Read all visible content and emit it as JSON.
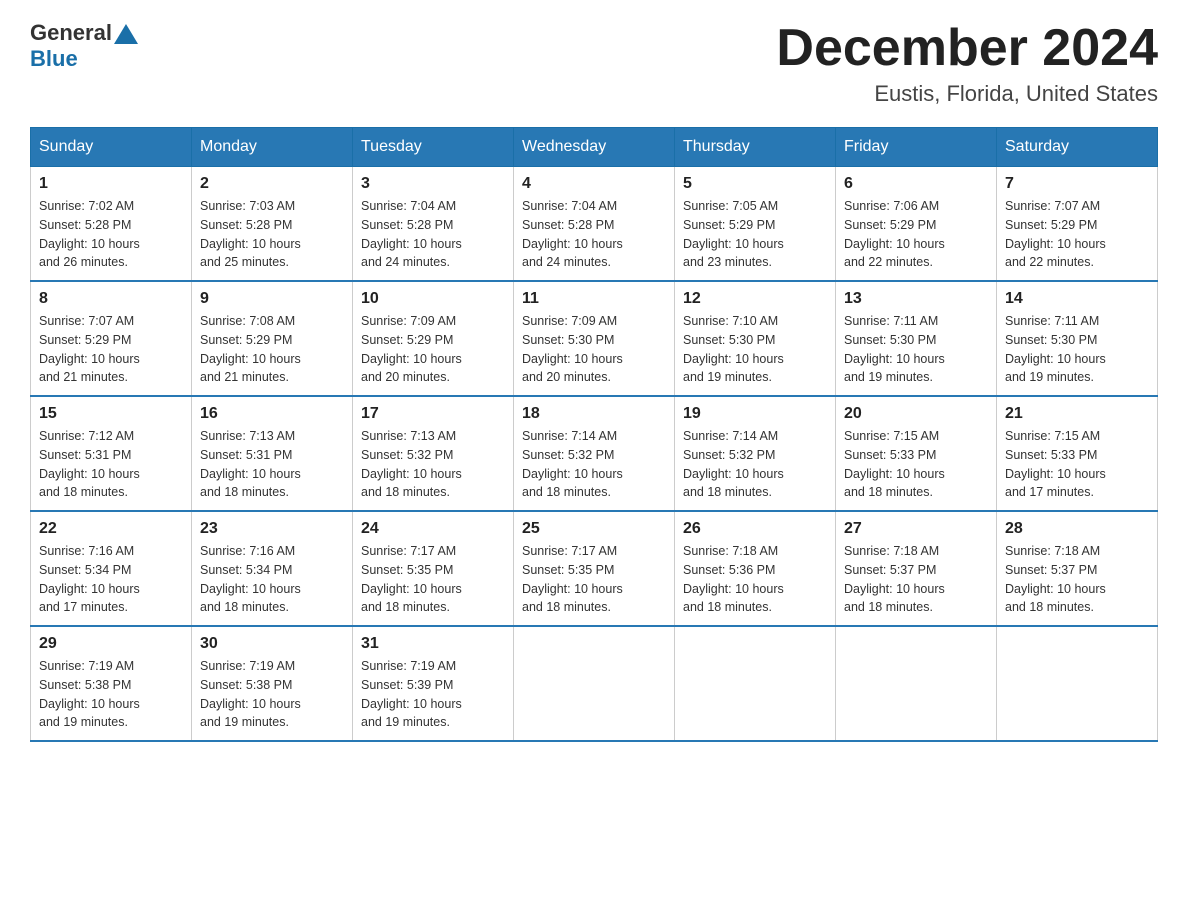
{
  "header": {
    "logo_general": "General",
    "logo_blue": "Blue",
    "month_title": "December 2024",
    "location": "Eustis, Florida, United States"
  },
  "days_of_week": [
    "Sunday",
    "Monday",
    "Tuesday",
    "Wednesday",
    "Thursday",
    "Friday",
    "Saturday"
  ],
  "weeks": [
    [
      {
        "day": "1",
        "sunrise": "7:02 AM",
        "sunset": "5:28 PM",
        "daylight": "10 hours and 26 minutes."
      },
      {
        "day": "2",
        "sunrise": "7:03 AM",
        "sunset": "5:28 PM",
        "daylight": "10 hours and 25 minutes."
      },
      {
        "day": "3",
        "sunrise": "7:04 AM",
        "sunset": "5:28 PM",
        "daylight": "10 hours and 24 minutes."
      },
      {
        "day": "4",
        "sunrise": "7:04 AM",
        "sunset": "5:28 PM",
        "daylight": "10 hours and 24 minutes."
      },
      {
        "day": "5",
        "sunrise": "7:05 AM",
        "sunset": "5:29 PM",
        "daylight": "10 hours and 23 minutes."
      },
      {
        "day": "6",
        "sunrise": "7:06 AM",
        "sunset": "5:29 PM",
        "daylight": "10 hours and 22 minutes."
      },
      {
        "day": "7",
        "sunrise": "7:07 AM",
        "sunset": "5:29 PM",
        "daylight": "10 hours and 22 minutes."
      }
    ],
    [
      {
        "day": "8",
        "sunrise": "7:07 AM",
        "sunset": "5:29 PM",
        "daylight": "10 hours and 21 minutes."
      },
      {
        "day": "9",
        "sunrise": "7:08 AM",
        "sunset": "5:29 PM",
        "daylight": "10 hours and 21 minutes."
      },
      {
        "day": "10",
        "sunrise": "7:09 AM",
        "sunset": "5:29 PM",
        "daylight": "10 hours and 20 minutes."
      },
      {
        "day": "11",
        "sunrise": "7:09 AM",
        "sunset": "5:30 PM",
        "daylight": "10 hours and 20 minutes."
      },
      {
        "day": "12",
        "sunrise": "7:10 AM",
        "sunset": "5:30 PM",
        "daylight": "10 hours and 19 minutes."
      },
      {
        "day": "13",
        "sunrise": "7:11 AM",
        "sunset": "5:30 PM",
        "daylight": "10 hours and 19 minutes."
      },
      {
        "day": "14",
        "sunrise": "7:11 AM",
        "sunset": "5:30 PM",
        "daylight": "10 hours and 19 minutes."
      }
    ],
    [
      {
        "day": "15",
        "sunrise": "7:12 AM",
        "sunset": "5:31 PM",
        "daylight": "10 hours and 18 minutes."
      },
      {
        "day": "16",
        "sunrise": "7:13 AM",
        "sunset": "5:31 PM",
        "daylight": "10 hours and 18 minutes."
      },
      {
        "day": "17",
        "sunrise": "7:13 AM",
        "sunset": "5:32 PM",
        "daylight": "10 hours and 18 minutes."
      },
      {
        "day": "18",
        "sunrise": "7:14 AM",
        "sunset": "5:32 PM",
        "daylight": "10 hours and 18 minutes."
      },
      {
        "day": "19",
        "sunrise": "7:14 AM",
        "sunset": "5:32 PM",
        "daylight": "10 hours and 18 minutes."
      },
      {
        "day": "20",
        "sunrise": "7:15 AM",
        "sunset": "5:33 PM",
        "daylight": "10 hours and 18 minutes."
      },
      {
        "day": "21",
        "sunrise": "7:15 AM",
        "sunset": "5:33 PM",
        "daylight": "10 hours and 17 minutes."
      }
    ],
    [
      {
        "day": "22",
        "sunrise": "7:16 AM",
        "sunset": "5:34 PM",
        "daylight": "10 hours and 17 minutes."
      },
      {
        "day": "23",
        "sunrise": "7:16 AM",
        "sunset": "5:34 PM",
        "daylight": "10 hours and 18 minutes."
      },
      {
        "day": "24",
        "sunrise": "7:17 AM",
        "sunset": "5:35 PM",
        "daylight": "10 hours and 18 minutes."
      },
      {
        "day": "25",
        "sunrise": "7:17 AM",
        "sunset": "5:35 PM",
        "daylight": "10 hours and 18 minutes."
      },
      {
        "day": "26",
        "sunrise": "7:18 AM",
        "sunset": "5:36 PM",
        "daylight": "10 hours and 18 minutes."
      },
      {
        "day": "27",
        "sunrise": "7:18 AM",
        "sunset": "5:37 PM",
        "daylight": "10 hours and 18 minutes."
      },
      {
        "day": "28",
        "sunrise": "7:18 AM",
        "sunset": "5:37 PM",
        "daylight": "10 hours and 18 minutes."
      }
    ],
    [
      {
        "day": "29",
        "sunrise": "7:19 AM",
        "sunset": "5:38 PM",
        "daylight": "10 hours and 19 minutes."
      },
      {
        "day": "30",
        "sunrise": "7:19 AM",
        "sunset": "5:38 PM",
        "daylight": "10 hours and 19 minutes."
      },
      {
        "day": "31",
        "sunrise": "7:19 AM",
        "sunset": "5:39 PM",
        "daylight": "10 hours and 19 minutes."
      },
      null,
      null,
      null,
      null
    ]
  ],
  "labels": {
    "sunrise": "Sunrise:",
    "sunset": "Sunset:",
    "daylight": "Daylight:"
  }
}
